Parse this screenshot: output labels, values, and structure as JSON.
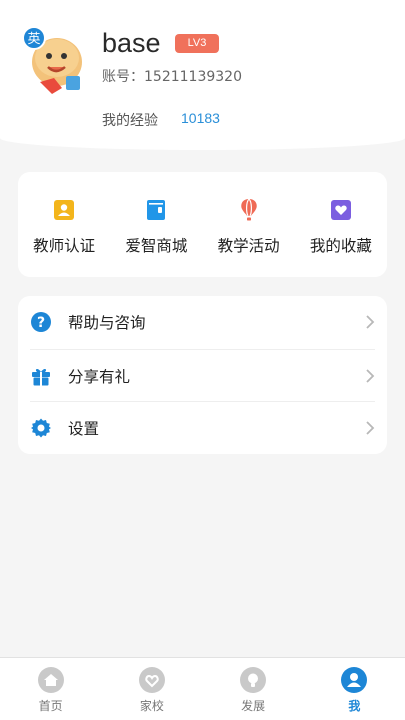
{
  "profile": {
    "avatar_badge": "英",
    "username": "base",
    "level": "LV3",
    "account": "账号：15211139320",
    "exp_label": "我的经验",
    "exp_value": "10183"
  },
  "quick_actions": [
    {
      "label": "教师认证",
      "icon": "teacher-id-icon",
      "color": "#f3b51b"
    },
    {
      "label": "爱智商城",
      "icon": "wallet-icon",
      "color": "#2196e8"
    },
    {
      "label": "教学活动",
      "icon": "hot-air-balloon-icon",
      "color": "#ef6a55"
    },
    {
      "label": "我的收藏",
      "icon": "heart-icon",
      "color": "#7b5ee0"
    }
  ],
  "menu": [
    {
      "label": "帮助与咨询",
      "icon": "help-icon"
    },
    {
      "label": "分享有礼",
      "icon": "gift-icon"
    },
    {
      "label": "设置",
      "icon": "gear-icon"
    }
  ],
  "tabs": [
    {
      "label": "首页",
      "icon": "home-icon",
      "active": false
    },
    {
      "label": "家校",
      "icon": "heart-hands-icon",
      "active": false
    },
    {
      "label": "发展",
      "icon": "lightbulb-icon",
      "active": false
    },
    {
      "label": "我",
      "icon": "user-icon",
      "active": true
    }
  ],
  "colors": {
    "accent": "#1d86d6",
    "badge": "#f0715b",
    "exp_value": "#2a8fd8"
  }
}
